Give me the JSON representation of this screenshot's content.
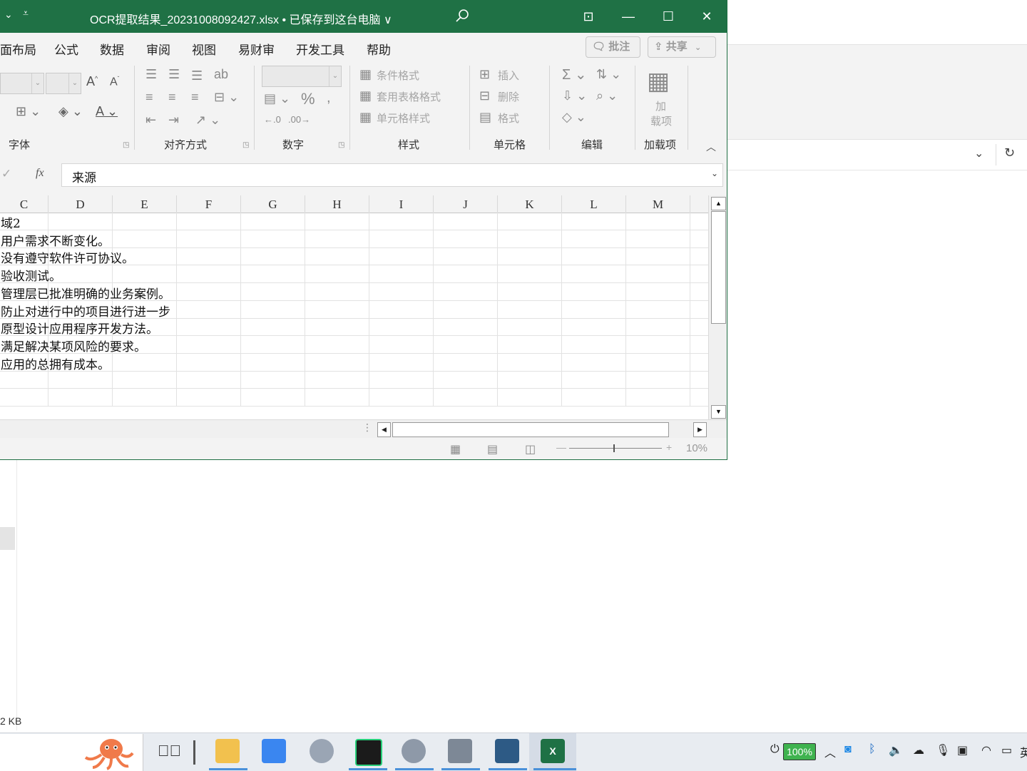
{
  "window": {
    "title": "OCR提取结果_20231008092427.xlsx • 已保存到这台电脑 ∨",
    "accent": "#1f7145"
  },
  "menu": {
    "items": [
      "面布局",
      "公式",
      "数据",
      "审阅",
      "视图",
      "易财审",
      "开发工具",
      "帮助"
    ],
    "comment_button": "批注",
    "share_button": "共享"
  },
  "ribbon": {
    "groups": {
      "font": "字体",
      "alignment": "对齐方式",
      "number": "数字",
      "styles": "样式",
      "cells": "单元格",
      "editing": "编辑",
      "addins": "加载项"
    },
    "styles": {
      "conditional": "条件格式",
      "table_format": "套用表格格式",
      "cell_styles": "单元格样式"
    },
    "cells": {
      "insert": "插入",
      "delete": "删除",
      "format": "格式"
    },
    "addins": {
      "top": "加",
      "bottom": "载项"
    }
  },
  "formula_bar": {
    "fx": "fx",
    "value": "来源"
  },
  "grid": {
    "columns": [
      "C",
      "D",
      "E",
      "F",
      "G",
      "H",
      "I",
      "J",
      "K",
      "L",
      "M"
    ],
    "rows": [
      "域2",
      "用户需求不断变化。",
      "没有遵守软件许可协议。",
      "验收测试。",
      "管理层已批准明确的业务案例。",
      "防止对进行中的项目进行进一步",
      "原型设计应用程序开发方法。",
      "满足解决某项风险的要求。",
      "应用的总拥有成本。",
      "",
      ""
    ]
  },
  "status": {
    "zoom": "10%"
  },
  "background_window": {
    "file_size": "2 KB"
  },
  "taskbar": {
    "battery": "100%",
    "apps": [
      "file-explorer",
      "feishu",
      "app-3",
      "pycharm",
      "app-5",
      "app-6",
      "python",
      "excel"
    ]
  }
}
